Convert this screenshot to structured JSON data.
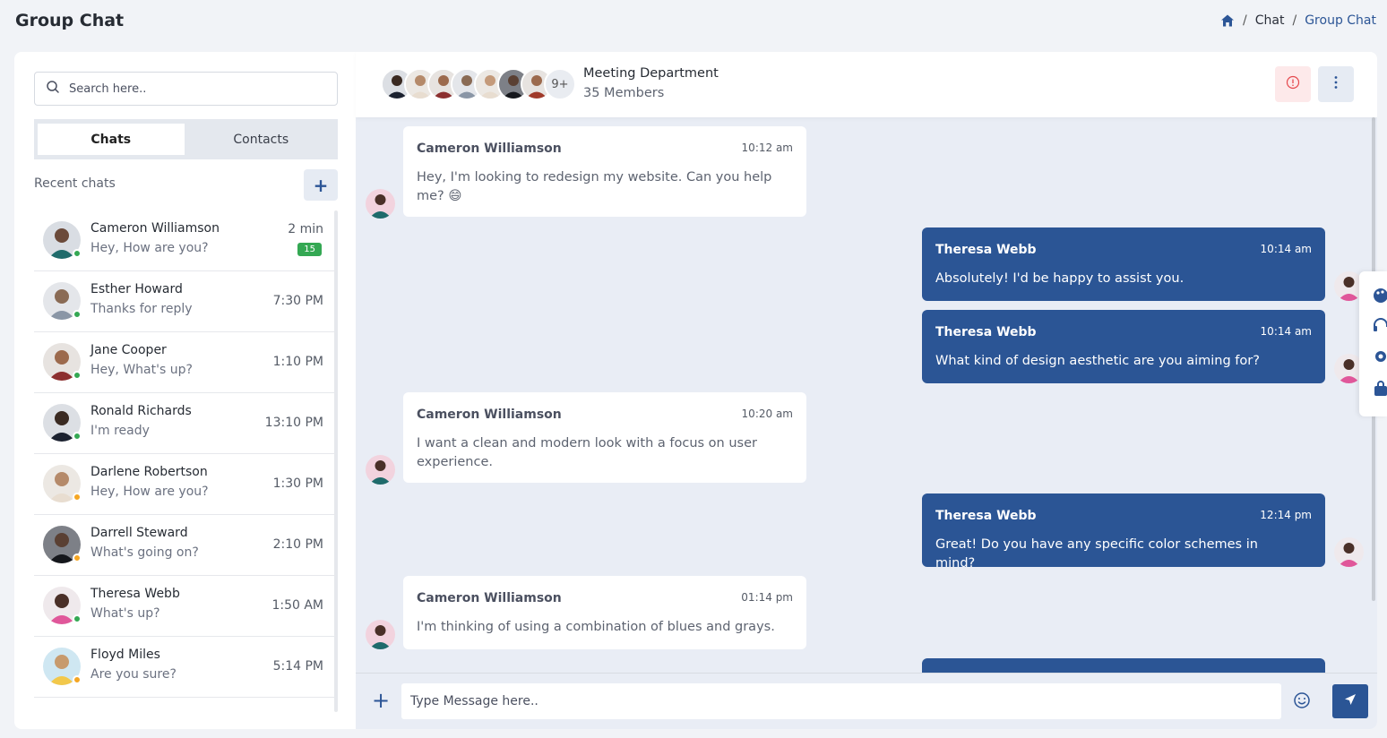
{
  "page": {
    "title": "Group Chat"
  },
  "breadcrumb": {
    "home_icon": "home-icon",
    "items": [
      "Chat",
      "Group Chat"
    ]
  },
  "sidebar": {
    "search_placeholder": "Search here..",
    "tabs": [
      {
        "label": "Chats",
        "active": true
      },
      {
        "label": "Contacts",
        "active": false
      }
    ],
    "recent_label": "Recent chats",
    "add_label": "+",
    "chats": [
      {
        "name": "Cameron Williamson",
        "preview": "Hey, How are you?",
        "time": "2 min",
        "badge": "15",
        "status": "online"
      },
      {
        "name": "Esther Howard",
        "preview": "Thanks for reply",
        "time": "7:30 PM",
        "status": "online"
      },
      {
        "name": "Jane Cooper",
        "preview": "Hey, What's up?",
        "time": "1:10 PM",
        "status": "online"
      },
      {
        "name": "Ronald Richards",
        "preview": "I'm ready",
        "time": "13:10 PM",
        "status": "online"
      },
      {
        "name": "Darlene Robertson",
        "preview": "Hey, How are you?",
        "time": "1:30 PM",
        "status": "away"
      },
      {
        "name": "Darrell Steward",
        "preview": "What's going on?",
        "time": "2:10 PM",
        "status": "away"
      },
      {
        "name": "Theresa Webb",
        "preview": "What's up?",
        "time": "1:50 AM",
        "status": "online"
      },
      {
        "name": "Floyd Miles",
        "preview": "Are you sure?",
        "time": "5:14 PM",
        "status": "away"
      }
    ]
  },
  "header": {
    "group_name": "Meeting Department",
    "members": "35 Members",
    "more_members": "9+"
  },
  "messages": [
    {
      "sender": "Cameron Williamson",
      "time": "10:12 am",
      "text": "Hey, I'm looking to redesign my website. Can you help me? 😄",
      "direction": "in"
    },
    {
      "sender": "Theresa Webb",
      "time": "10:14 am",
      "text": "Absolutely! I'd be happy to assist you.",
      "direction": "out"
    },
    {
      "sender": "Theresa Webb",
      "time": "10:14 am",
      "text": "What kind of design aesthetic are you aiming for?",
      "direction": "out"
    },
    {
      "sender": "Cameron Williamson",
      "time": "10:20 am",
      "text": "I want a clean and modern look with a focus on user experience.",
      "direction": "in"
    },
    {
      "sender": "Theresa Webb",
      "time": "12:14 pm",
      "text": "Great! Do you have any specific color schemes in mind?",
      "direction": "out"
    },
    {
      "sender": "Cameron Williamson",
      "time": "01:14 pm",
      "text": "I'm thinking of using a combination of blues and grays.",
      "direction": "in"
    }
  ],
  "composer": {
    "placeholder": "Type Message here..",
    "plus_label": "+"
  },
  "colors": {
    "primary": "#2b5595",
    "online": "#34a853",
    "away": "#f5a623",
    "chat_bg": "#e9edf5",
    "danger_bg": "#fde9ea"
  }
}
